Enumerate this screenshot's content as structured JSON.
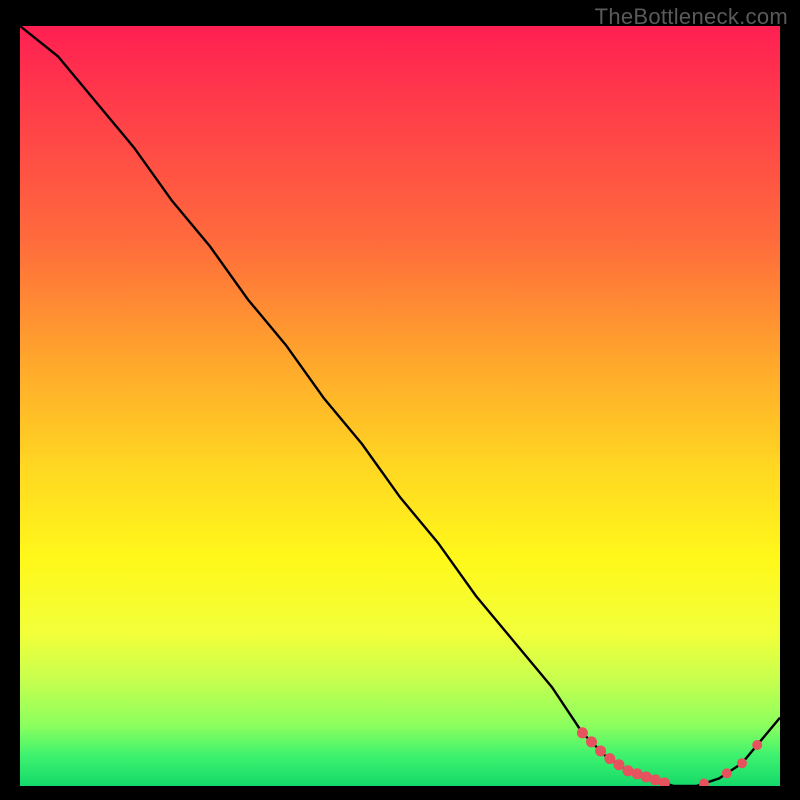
{
  "watermark": "TheBottleneck.com",
  "chart_data": {
    "type": "line",
    "title": "",
    "xlabel": "",
    "ylabel": "",
    "xlim": [
      0,
      100
    ],
    "ylim": [
      0,
      100
    ],
    "series": [
      {
        "name": "curve",
        "x": [
          0,
          5,
          10,
          15,
          20,
          25,
          30,
          35,
          40,
          45,
          50,
          55,
          60,
          65,
          70,
          74,
          77,
          80,
          83,
          86,
          89,
          92,
          95,
          100
        ],
        "y": [
          100,
          96,
          90,
          84,
          77,
          71,
          64,
          58,
          51,
          45,
          38,
          32,
          25,
          19,
          13,
          7,
          4,
          2,
          1,
          0,
          0,
          1,
          3,
          9
        ]
      }
    ],
    "annotations": {
      "marker_cluster_x_range": [
        74,
        97
      ],
      "marker_color": "#e6525d"
    }
  }
}
